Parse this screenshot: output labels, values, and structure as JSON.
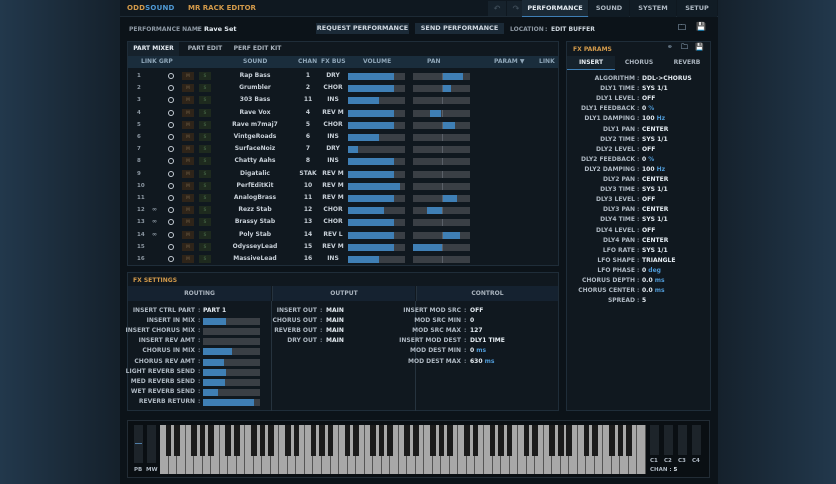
{
  "app": {
    "brand_a": "ODD",
    "brand_b": "SOUND",
    "title": "MR RACK EDITOR"
  },
  "nav": {
    "undo": "↶",
    "redo": "↷",
    "tabs": [
      {
        "label": "PERFORMANCE",
        "active": true
      },
      {
        "label": "SOUND"
      },
      {
        "label": "SYSTEM"
      },
      {
        "label": "SETUP"
      }
    ]
  },
  "perf": {
    "name_label": "PERFORMANCE NAME",
    "name_value": "Rave Set",
    "request": "REQUEST PERFORMANCE",
    "send": "SEND PERFORMANCE",
    "location_label": "LOCATION",
    "location_value": "EDIT BUFFER"
  },
  "mixer": {
    "tabs": [
      "PART MIXER",
      "PART EDIT",
      "PERF EDIT KIT"
    ],
    "headers": {
      "link_grp": "LINK GRP",
      "sound": "SOUND",
      "chan": "CHAN",
      "fx_bus": "FX BUS",
      "volume": "VOLUME",
      "pan": "PAN",
      "param": "PARAM ▼",
      "link": "LINK"
    },
    "mute": "M",
    "solo": "S",
    "rows": [
      {
        "n": "1",
        "sound": "Rap Bass",
        "chan": "1",
        "bus": "DRY",
        "vol": 0.8,
        "pan": 0.76,
        "link": false
      },
      {
        "n": "2",
        "sound": "Grumbler",
        "chan": "2",
        "bus": "CHOR",
        "vol": 0.8,
        "pan": 0.33,
        "link": false
      },
      {
        "n": "3",
        "sound": "303 Bass",
        "chan": "11",
        "bus": "INS",
        "vol": 0.55,
        "pan": 0,
        "link": false
      },
      {
        "n": "4",
        "sound": "Rave Vox",
        "chan": "4",
        "bus": "REV M",
        "vol": 0.8,
        "pan": -0.4,
        "link": false
      },
      {
        "n": "5",
        "sound": "Rave m7maj7",
        "chan": "5",
        "bus": "CHOR",
        "vol": 0.8,
        "pan": 0.47,
        "link": false
      },
      {
        "n": "6",
        "sound": "VintgeRoads",
        "chan": "6",
        "bus": "INS",
        "vol": 0.55,
        "pan": 0,
        "link": false
      },
      {
        "n": "7",
        "sound": "SurfaceNoiz",
        "chan": "7",
        "bus": "DRY",
        "vol": 0.18,
        "pan": 0,
        "link": false
      },
      {
        "n": "8",
        "sound": "Chatty Aahs",
        "chan": "8",
        "bus": "INS",
        "vol": 0.8,
        "pan": 0,
        "link": false
      },
      {
        "n": "9",
        "sound": "Digatalic",
        "chan": "STAK",
        "bus": "REV M",
        "vol": 0.8,
        "pan": 0,
        "link": false
      },
      {
        "n": "10",
        "sound": "PerfEditKit",
        "chan": "10",
        "bus": "REV M",
        "vol": 0.92,
        "pan": 0,
        "link": false
      },
      {
        "n": "11",
        "sound": "AnalogBrass",
        "chan": "11",
        "bus": "REV M",
        "vol": 0.8,
        "pan": 0.55,
        "link": false
      },
      {
        "n": "12",
        "sound": "Rezz Stab",
        "chan": "12",
        "bus": "CHOR",
        "vol": 0.63,
        "pan": -0.5,
        "link": true
      },
      {
        "n": "13",
        "sound": "Brassy Stab",
        "chan": "13",
        "bus": "CHOR",
        "vol": 0.8,
        "pan": 0,
        "link": true
      },
      {
        "n": "14",
        "sound": "Poly Stab",
        "chan": "14",
        "bus": "REV L",
        "vol": 0.8,
        "pan": 0.65,
        "link": true
      },
      {
        "n": "15",
        "sound": "OdysseyLead",
        "chan": "15",
        "bus": "REV M",
        "vol": 0.8,
        "pan": -1.0,
        "link": false
      },
      {
        "n": "16",
        "sound": "MassiveLead",
        "chan": "16",
        "bus": "INS",
        "vol": 0.55,
        "pan": 0,
        "link": false
      }
    ]
  },
  "fx_params": {
    "title": "FX PARAMS",
    "tabs": [
      "INSERT",
      "CHORUS",
      "REVERB"
    ],
    "params": [
      {
        "k": "ALGORITHM",
        "v": "DDL->CHORUS"
      },
      {
        "k": "DLY1 TIME",
        "v": "SYS 1/1"
      },
      {
        "k": "DLY1 LEVEL",
        "v": "OFF"
      },
      {
        "k": "DLY1 FEEDBACK",
        "v": "0",
        "u": "%"
      },
      {
        "k": "DLY1 DAMPING",
        "v": "100",
        "u": "Hz"
      },
      {
        "k": "DLY1 PAN",
        "v": "CENTER"
      },
      {
        "k": "DLY2 TIME",
        "v": "SYS 1/1"
      },
      {
        "k": "DLY2 LEVEL",
        "v": "OFF"
      },
      {
        "k": "DLY2 FEEDBACK",
        "v": "0",
        "u": "%"
      },
      {
        "k": "DLY2 DAMPING",
        "v": "100",
        "u": "Hz"
      },
      {
        "k": "DLY2 PAN",
        "v": "CENTER"
      },
      {
        "k": "DLY3 TIME",
        "v": "SYS 1/1"
      },
      {
        "k": "DLY3 LEVEL",
        "v": "OFF"
      },
      {
        "k": "DLY3 PAN",
        "v": "CENTER"
      },
      {
        "k": "DLY4 TIME",
        "v": "SYS 1/1"
      },
      {
        "k": "DLY4 LEVEL",
        "v": "OFF"
      },
      {
        "k": "DLY4 PAN",
        "v": "CENTER"
      },
      {
        "k": "LFO RATE",
        "v": "SYS 1/1"
      },
      {
        "k": "LFO SHAPE",
        "v": "TRIANGLE"
      },
      {
        "k": "LFO PHASE",
        "v": "0",
        "u": "deg"
      },
      {
        "k": "CHORUS DEPTH",
        "v": "0.0",
        "u": "ms"
      },
      {
        "k": "CHORUS CENTER",
        "v": "0.0",
        "u": "ms"
      },
      {
        "k": "SPREAD",
        "v": "5"
      }
    ]
  },
  "fx_settings": {
    "title": "FX SETTINGS",
    "routing_title": "ROUTING",
    "output_title": "OUTPUT",
    "control_title": "CONTROL",
    "routing": [
      {
        "k": "INSERT CTRL PART",
        "v": "PART 1"
      },
      {
        "k": "INSERT IN MIX",
        "bar": 0.41
      },
      {
        "k": "INSERT CHORUS MIX",
        "bar": 0
      },
      {
        "k": "INSERT REV AMT",
        "bar": 0
      },
      {
        "k": "CHORUS IN MIX",
        "bar": 0.51
      },
      {
        "k": "CHORUS REV AMT",
        "bar": 0.37
      },
      {
        "k": "LIGHT REVERB SEND",
        "bar": 0.4
      },
      {
        "k": "MED REVERB SEND",
        "bar": 0.38
      },
      {
        "k": "WET REVERB SEND",
        "bar": 0.26
      },
      {
        "k": "REVERB RETURN",
        "bar": 0.9
      }
    ],
    "output": [
      {
        "k": "INSERT OUT",
        "v": "MAIN"
      },
      {
        "k": "CHORUS OUT",
        "v": "MAIN"
      },
      {
        "k": "REVERB OUT",
        "v": "MAIN"
      },
      {
        "k": "DRY OUT",
        "v": "MAIN"
      }
    ],
    "control": [
      {
        "k": "INSERT MOD SRC",
        "v": "OFF"
      },
      {
        "k": "MOD SRC MIN",
        "v": "0"
      },
      {
        "k": "MOD SRC MAX",
        "v": "127"
      },
      {
        "k": "INSERT MOD DEST",
        "v": "DLY1 TIME"
      },
      {
        "k": "MOD DEST MIN",
        "v": "0",
        "u": "ms"
      },
      {
        "k": "MOD DEST MAX",
        "v": "630",
        "u": "ms"
      }
    ]
  },
  "keyboard": {
    "pb": "PB",
    "mw": "MW",
    "controls": [
      "C1",
      "C2",
      "C3",
      "C4"
    ],
    "chan_label": "CHAN",
    "chan_value": "5",
    "pb_value": 0.5,
    "mw_value": 0
  }
}
